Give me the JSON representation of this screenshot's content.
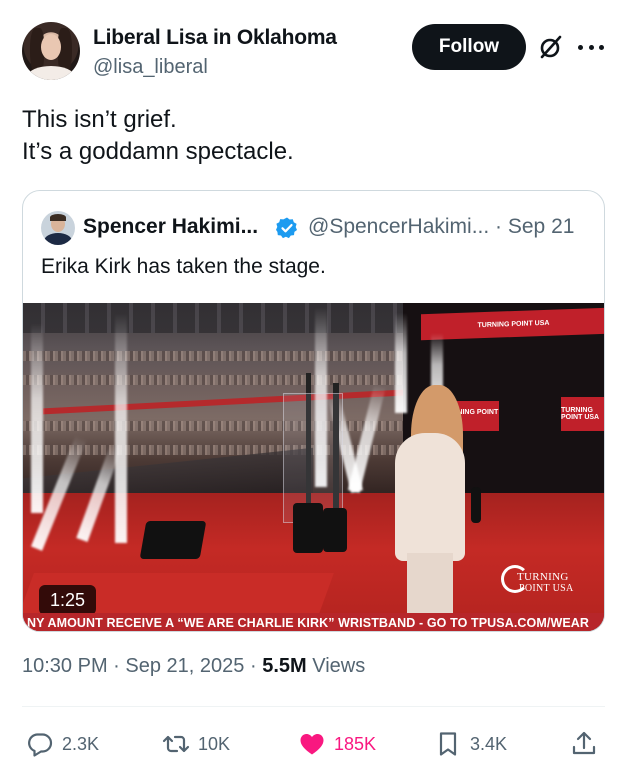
{
  "tweet": {
    "author": {
      "display_name": "Liberal Lisa in Oklahoma",
      "handle": "@lisa_liberal"
    },
    "follow_label": "Follow",
    "text_line1": "This isn’t grief.",
    "text_line2": "It’s a goddamn spectacle.",
    "time": "10:30 PM",
    "date": "Sep 21, 2025",
    "separator": "·",
    "views_count": "5.5M",
    "views_label": "Views"
  },
  "quote": {
    "display_name": "Spencer Hakimi...",
    "handle_date": "@SpencerHakimi... · Sep 21",
    "text": "Erika Kirk has taken the stage.",
    "video": {
      "duration": "1:25",
      "ticker": "NY AMOUNT RECEIVE A “WE ARE CHARLIE KIRK” WRISTBAND - GO TO TPUSA.COM/WEAR",
      "logo_line1": "TURNING",
      "logo_line2": "POINT USA",
      "banner_text": "TURNING POINT USA"
    }
  },
  "actions": {
    "replies": "2.3K",
    "reposts": "10K",
    "likes": "185K",
    "bookmarks": "3.4K"
  },
  "colors": {
    "text": "#0f1419",
    "secondary": "#536471",
    "verified": "#1d9bf0",
    "like": "#f91880",
    "border": "#cfd9de"
  }
}
